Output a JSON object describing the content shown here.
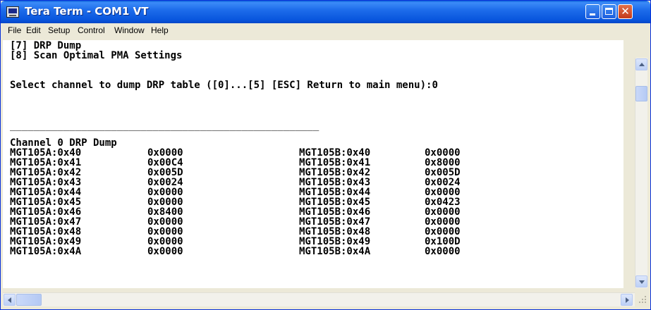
{
  "window": {
    "title": "Tera Term - COM1 VT"
  },
  "menu": [
    "File",
    "Edit",
    "Setup",
    "Control",
    "Window",
    "Help"
  ],
  "terminal": {
    "lines": [
      "[7] DRP Dump",
      "[8] Scan Optimal PMA Settings",
      "",
      "Select channel to dump DRP table ([0]...[5] [ESC] Return to main menu):0",
      "",
      "____________________________________________________",
      "Channel 0 DRP Dump"
    ],
    "rows": [
      {
        "a_reg": "MGT105A:0x40",
        "a_val": "0x0000",
        "b_reg": "MGT105B:0x40",
        "b_val": "0x0000"
      },
      {
        "a_reg": "MGT105A:0x41",
        "a_val": "0x00C4",
        "b_reg": "MGT105B:0x41",
        "b_val": "0x8000"
      },
      {
        "a_reg": "MGT105A:0x42",
        "a_val": "0x005D",
        "b_reg": "MGT105B:0x42",
        "b_val": "0x005D"
      },
      {
        "a_reg": "MGT105A:0x43",
        "a_val": "0x0024",
        "b_reg": "MGT105B:0x43",
        "b_val": "0x0024"
      },
      {
        "a_reg": "MGT105A:0x44",
        "a_val": "0x0000",
        "b_reg": "MGT105B:0x44",
        "b_val": "0x0000"
      },
      {
        "a_reg": "MGT105A:0x45",
        "a_val": "0x0000",
        "b_reg": "MGT105B:0x45",
        "b_val": "0x0423"
      },
      {
        "a_reg": "MGT105A:0x46",
        "a_val": "0x8400",
        "b_reg": "MGT105B:0x46",
        "b_val": "0x0000"
      },
      {
        "a_reg": "MGT105A:0x47",
        "a_val": "0x0000",
        "b_reg": "MGT105B:0x47",
        "b_val": "0x0000"
      },
      {
        "a_reg": "MGT105A:0x48",
        "a_val": "0x0000",
        "b_reg": "MGT105B:0x48",
        "b_val": "0x0000"
      },
      {
        "a_reg": "MGT105A:0x49",
        "a_val": "0x0000",
        "b_reg": "MGT105B:0x49",
        "b_val": "0x100D"
      },
      {
        "a_reg": "MGT105A:0x4A",
        "a_val": "0x0000",
        "b_reg": "MGT105B:0x4A",
        "b_val": "0x0000"
      }
    ]
  },
  "icons": {
    "app": "tera-term-icon",
    "minimize": "minimize-icon",
    "maximize": "maximize-icon",
    "close": "close-icon"
  },
  "colors": {
    "titlebar": "#0A5FD8",
    "close_button": "#C33A1A",
    "terminal_bg": "#FFFFFF",
    "terminal_fg": "#000000"
  }
}
